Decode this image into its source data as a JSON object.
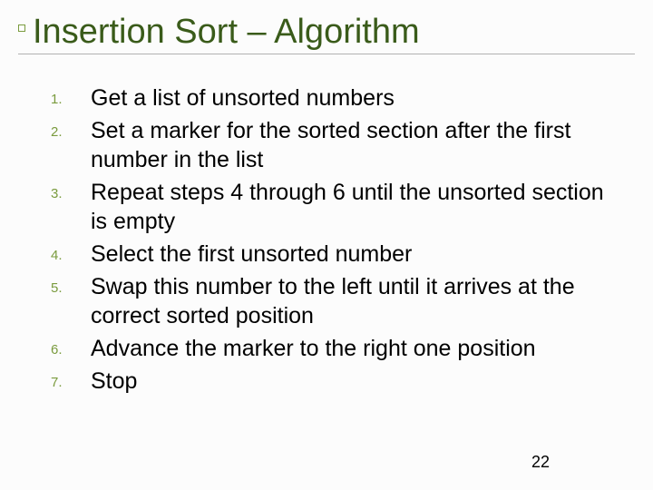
{
  "title": "Insertion Sort – Algorithm",
  "steps": [
    {
      "num": "1.",
      "text": "Get a list of unsorted numbers"
    },
    {
      "num": "2.",
      "text": "Set a marker for the sorted section after the first number in the list"
    },
    {
      "num": "3.",
      "text": "Repeat steps 4 through 6 until the unsorted section is empty"
    },
    {
      "num": "4.",
      "text": "Select the first unsorted number"
    },
    {
      "num": "5.",
      "text": "Swap this number to the left until it arrives at the correct sorted position"
    },
    {
      "num": "6.",
      "text": "Advance the marker to the right one position"
    },
    {
      "num": "7.",
      "text": "Stop"
    }
  ],
  "page_number": "22"
}
